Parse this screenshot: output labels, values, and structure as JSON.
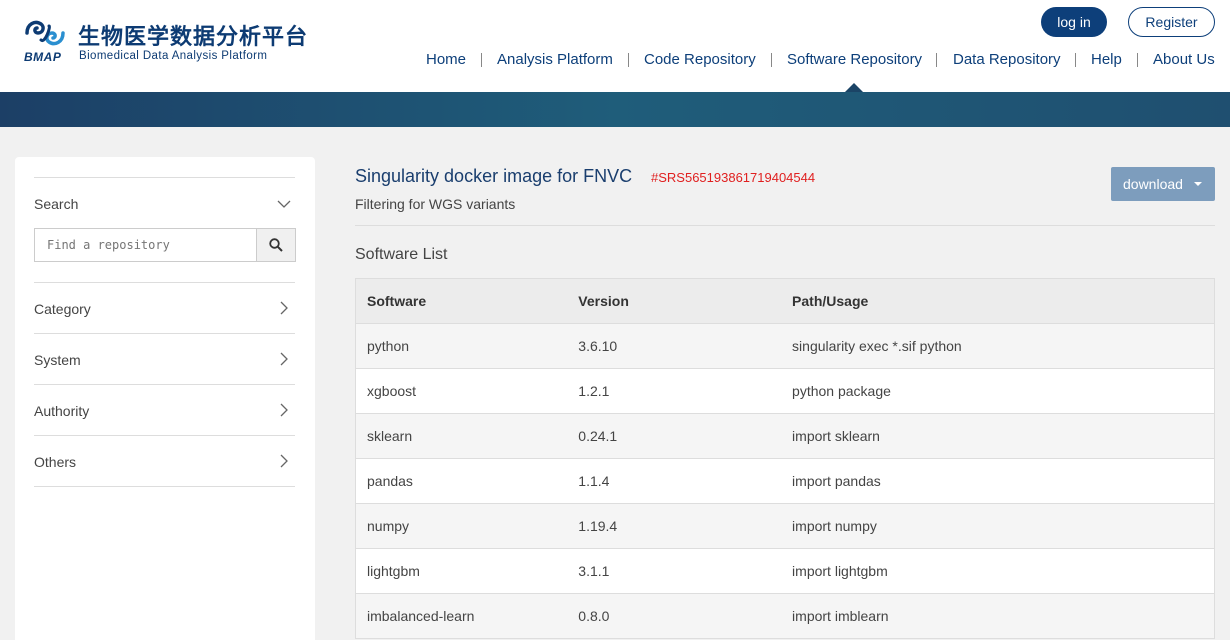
{
  "header": {
    "logo": {
      "cn": "生物医学数据分析平台",
      "abbr": "BMAP",
      "en": "Biomedical Data Analysis Platform"
    },
    "login_label": "log in",
    "register_label": "Register",
    "nav": [
      "Home",
      "Analysis Platform",
      "Code Repository",
      "Software Repository",
      "Data Repository",
      "Help",
      "About Us"
    ],
    "active_nav": "Software Repository"
  },
  "sidebar": {
    "search_label": "Search",
    "search_placeholder": "Find a repository",
    "filters": [
      "Category",
      "System",
      "Authority",
      "Others"
    ]
  },
  "main": {
    "title": "Singularity docker image for FNVC",
    "id": "#SRS565193861719404544",
    "subtitle": "Filtering for WGS variants",
    "download_label": "download",
    "section_title": "Software List",
    "table": {
      "headers": [
        "Software",
        "Version",
        "Path/Usage"
      ],
      "rows": [
        [
          "python",
          "3.6.10",
          "singularity exec *.sif python"
        ],
        [
          "xgboost",
          "1.2.1",
          "python package"
        ],
        [
          "sklearn",
          "0.24.1",
          "import sklearn"
        ],
        [
          "pandas",
          "1.1.4",
          "import pandas"
        ],
        [
          "numpy",
          "1.19.4",
          "import numpy"
        ],
        [
          "lightgbm",
          "3.1.1",
          "import lightgbm"
        ],
        [
          "imbalanced-learn",
          "0.8.0",
          "import imblearn"
        ]
      ]
    }
  },
  "colors": {
    "brand": "#0d3f7a",
    "accent_red": "#e02020",
    "download": "#7d9dbd"
  }
}
